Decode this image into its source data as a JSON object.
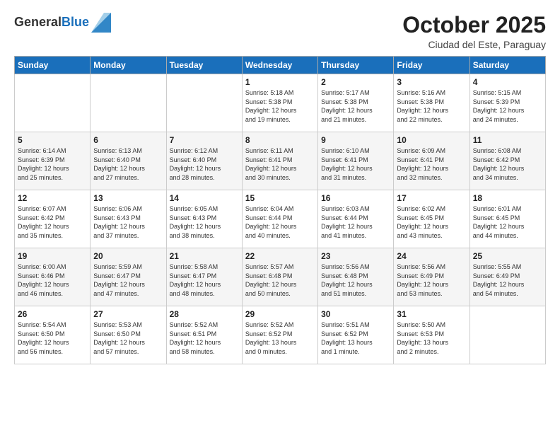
{
  "logo": {
    "general": "General",
    "blue": "Blue"
  },
  "header": {
    "month": "October 2025",
    "location": "Ciudad del Este, Paraguay"
  },
  "weekdays": [
    "Sunday",
    "Monday",
    "Tuesday",
    "Wednesday",
    "Thursday",
    "Friday",
    "Saturday"
  ],
  "weeks": [
    [
      {
        "day": "",
        "info": ""
      },
      {
        "day": "",
        "info": ""
      },
      {
        "day": "",
        "info": ""
      },
      {
        "day": "1",
        "info": "Sunrise: 5:18 AM\nSunset: 5:38 PM\nDaylight: 12 hours\nand 19 minutes."
      },
      {
        "day": "2",
        "info": "Sunrise: 5:17 AM\nSunset: 5:38 PM\nDaylight: 12 hours\nand 21 minutes."
      },
      {
        "day": "3",
        "info": "Sunrise: 5:16 AM\nSunset: 5:38 PM\nDaylight: 12 hours\nand 22 minutes."
      },
      {
        "day": "4",
        "info": "Sunrise: 5:15 AM\nSunset: 5:39 PM\nDaylight: 12 hours\nand 24 minutes."
      }
    ],
    [
      {
        "day": "5",
        "info": "Sunrise: 6:14 AM\nSunset: 6:39 PM\nDaylight: 12 hours\nand 25 minutes."
      },
      {
        "day": "6",
        "info": "Sunrise: 6:13 AM\nSunset: 6:40 PM\nDaylight: 12 hours\nand 27 minutes."
      },
      {
        "day": "7",
        "info": "Sunrise: 6:12 AM\nSunset: 6:40 PM\nDaylight: 12 hours\nand 28 minutes."
      },
      {
        "day": "8",
        "info": "Sunrise: 6:11 AM\nSunset: 6:41 PM\nDaylight: 12 hours\nand 30 minutes."
      },
      {
        "day": "9",
        "info": "Sunrise: 6:10 AM\nSunset: 6:41 PM\nDaylight: 12 hours\nand 31 minutes."
      },
      {
        "day": "10",
        "info": "Sunrise: 6:09 AM\nSunset: 6:41 PM\nDaylight: 12 hours\nand 32 minutes."
      },
      {
        "day": "11",
        "info": "Sunrise: 6:08 AM\nSunset: 6:42 PM\nDaylight: 12 hours\nand 34 minutes."
      }
    ],
    [
      {
        "day": "12",
        "info": "Sunrise: 6:07 AM\nSunset: 6:42 PM\nDaylight: 12 hours\nand 35 minutes."
      },
      {
        "day": "13",
        "info": "Sunrise: 6:06 AM\nSunset: 6:43 PM\nDaylight: 12 hours\nand 37 minutes."
      },
      {
        "day": "14",
        "info": "Sunrise: 6:05 AM\nSunset: 6:43 PM\nDaylight: 12 hours\nand 38 minutes."
      },
      {
        "day": "15",
        "info": "Sunrise: 6:04 AM\nSunset: 6:44 PM\nDaylight: 12 hours\nand 40 minutes."
      },
      {
        "day": "16",
        "info": "Sunrise: 6:03 AM\nSunset: 6:44 PM\nDaylight: 12 hours\nand 41 minutes."
      },
      {
        "day": "17",
        "info": "Sunrise: 6:02 AM\nSunset: 6:45 PM\nDaylight: 12 hours\nand 43 minutes."
      },
      {
        "day": "18",
        "info": "Sunrise: 6:01 AM\nSunset: 6:45 PM\nDaylight: 12 hours\nand 44 minutes."
      }
    ],
    [
      {
        "day": "19",
        "info": "Sunrise: 6:00 AM\nSunset: 6:46 PM\nDaylight: 12 hours\nand 46 minutes."
      },
      {
        "day": "20",
        "info": "Sunrise: 5:59 AM\nSunset: 6:47 PM\nDaylight: 12 hours\nand 47 minutes."
      },
      {
        "day": "21",
        "info": "Sunrise: 5:58 AM\nSunset: 6:47 PM\nDaylight: 12 hours\nand 48 minutes."
      },
      {
        "day": "22",
        "info": "Sunrise: 5:57 AM\nSunset: 6:48 PM\nDaylight: 12 hours\nand 50 minutes."
      },
      {
        "day": "23",
        "info": "Sunrise: 5:56 AM\nSunset: 6:48 PM\nDaylight: 12 hours\nand 51 minutes."
      },
      {
        "day": "24",
        "info": "Sunrise: 5:56 AM\nSunset: 6:49 PM\nDaylight: 12 hours\nand 53 minutes."
      },
      {
        "day": "25",
        "info": "Sunrise: 5:55 AM\nSunset: 6:49 PM\nDaylight: 12 hours\nand 54 minutes."
      }
    ],
    [
      {
        "day": "26",
        "info": "Sunrise: 5:54 AM\nSunset: 6:50 PM\nDaylight: 12 hours\nand 56 minutes."
      },
      {
        "day": "27",
        "info": "Sunrise: 5:53 AM\nSunset: 6:50 PM\nDaylight: 12 hours\nand 57 minutes."
      },
      {
        "day": "28",
        "info": "Sunrise: 5:52 AM\nSunset: 6:51 PM\nDaylight: 12 hours\nand 58 minutes."
      },
      {
        "day": "29",
        "info": "Sunrise: 5:52 AM\nSunset: 6:52 PM\nDaylight: 13 hours\nand 0 minutes."
      },
      {
        "day": "30",
        "info": "Sunrise: 5:51 AM\nSunset: 6:52 PM\nDaylight: 13 hours\nand 1 minute."
      },
      {
        "day": "31",
        "info": "Sunrise: 5:50 AM\nSunset: 6:53 PM\nDaylight: 13 hours\nand 2 minutes."
      },
      {
        "day": "",
        "info": ""
      }
    ]
  ]
}
